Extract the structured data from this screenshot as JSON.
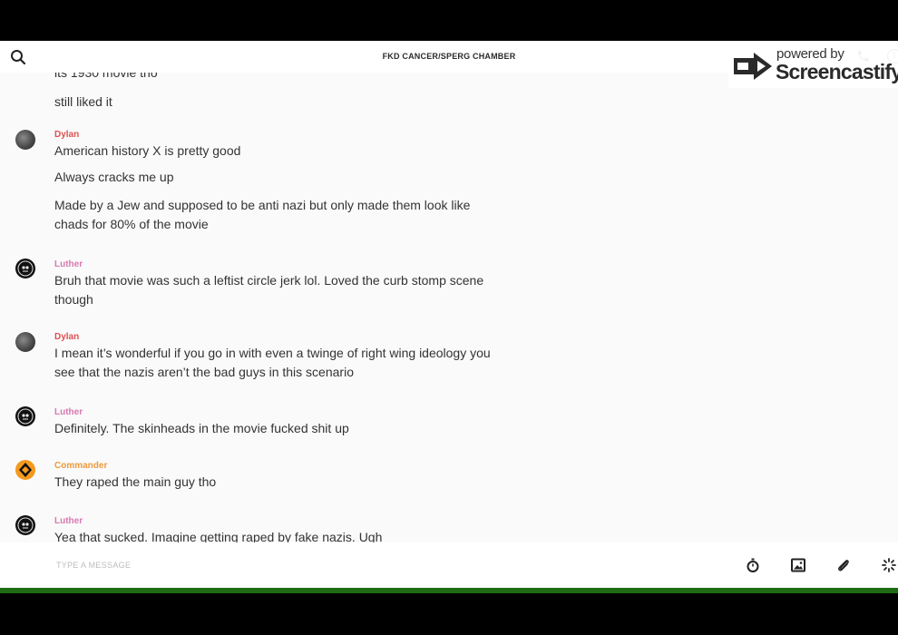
{
  "header": {
    "room_title": "FKD CANCER/SPERG CHAMBER"
  },
  "watermark": {
    "powered_by": "powered by",
    "brand": "Screencastify"
  },
  "messages": {
    "partial_top": "its 1930 movie tho",
    "still_liked": "still liked it",
    "dylan_1": {
      "author": "Dylan",
      "lines": [
        "American history X is pretty good",
        "Always cracks me up",
        "Made by a Jew and supposed to be anti nazi but only made them look like",
        "chads for 80% of the movie"
      ]
    },
    "luther_1": {
      "author": "Luther",
      "lines": [
        "Bruh that movie was such a leftist circle jerk lol. Loved the curb stomp scene",
        "though"
      ]
    },
    "dylan_2": {
      "author": "Dylan",
      "lines": [
        "I mean it’s wonderful if you go in with even a twinge of right wing ideology you",
        "see that the nazis aren’t the bad guys in this scenario"
      ]
    },
    "luther_2": {
      "author": "Luther",
      "lines": [
        "Definitely. The skinheads in the movie fucked shit up"
      ]
    },
    "commander_1": {
      "author": "Commander",
      "lines": [
        "They raped the main guy tho"
      ]
    },
    "luther_3": {
      "author": "Luther",
      "partial_line": "Yea that sucked. Imagine getting raped by fake nazis. Ugh"
    }
  },
  "composer": {
    "placeholder": "TYPE A MESSAGE"
  },
  "icons": {
    "search": "search-icon",
    "timer": "stopwatch-icon",
    "image": "image-icon",
    "attach": "paperclip-icon",
    "loading": "spinner-icon",
    "phone": "phone-icon",
    "info": "info-icon"
  },
  "colors": {
    "dylan_name": "#e05050",
    "luther_name": "#d77ab0",
    "commander_name": "#ee9a3a",
    "accent_bar": "#1f6b15"
  }
}
